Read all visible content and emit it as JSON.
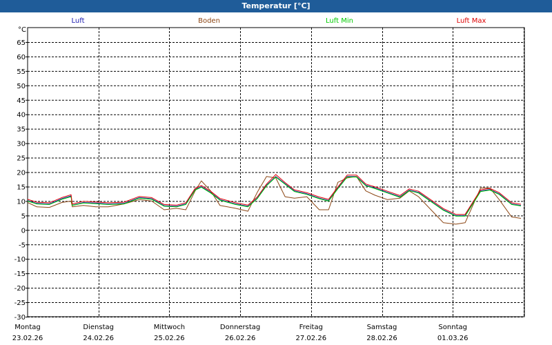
{
  "title": "Temperatur [°C]",
  "colors": {
    "titlebar": "#1f5c99"
  },
  "chart_data": {
    "type": "line",
    "title": "Temperatur [°C]",
    "ylabel": "°C",
    "xlabel": "",
    "ylim": [
      -30,
      70
    ],
    "yticks": [
      65,
      60,
      55,
      50,
      45,
      40,
      35,
      30,
      25,
      20,
      15,
      10,
      5,
      0,
      -5,
      -10,
      -15,
      -20,
      -25,
      -30
    ],
    "grid": true,
    "legend_position": "top",
    "x_ticks": [
      {
        "day": "Montag",
        "date": "23.02.26"
      },
      {
        "day": "Dienstag",
        "date": "24.02.26"
      },
      {
        "day": "Mittwoch",
        "date": "25.02.26"
      },
      {
        "day": "Donnerstag",
        "date": "26.02.26"
      },
      {
        "day": "Freitag",
        "date": "27.02.26"
      },
      {
        "day": "Samstag",
        "date": "28.02.26"
      },
      {
        "day": "Sonntag",
        "date": "01.03.26"
      }
    ],
    "x_unit": "days since 23.02.26 00:00",
    "xlim": [
      0,
      7.2
    ],
    "series": [
      {
        "name": "Luft",
        "color": "#1a1ab0",
        "points": [
          [
            0,
            10.2
          ],
          [
            0.15,
            9.2
          ],
          [
            0.35,
            9.0
          ],
          [
            0.55,
            10.8
          ],
          [
            0.7,
            11.8
          ],
          [
            0.72,
            8.6
          ],
          [
            0.9,
            9.5
          ],
          [
            1.1,
            9.3
          ],
          [
            1.3,
            9.0
          ],
          [
            1.55,
            9.2
          ],
          [
            1.8,
            11.2
          ],
          [
            2.0,
            10.8
          ],
          [
            2.2,
            8.4
          ],
          [
            2.4,
            8.2
          ],
          [
            2.55,
            9.0
          ],
          [
            2.7,
            14.0
          ],
          [
            2.8,
            15.0
          ],
          [
            2.95,
            13.0
          ],
          [
            3.1,
            10.5
          ],
          [
            3.35,
            9.0
          ],
          [
            3.55,
            8.2
          ],
          [
            3.7,
            11.0
          ],
          [
            3.85,
            15.5
          ],
          [
            4.0,
            18.5
          ],
          [
            4.15,
            16.0
          ],
          [
            4.3,
            13.5
          ],
          [
            4.5,
            12.5
          ],
          [
            4.7,
            11.0
          ],
          [
            4.85,
            10.2
          ],
          [
            5.0,
            14.5
          ],
          [
            5.15,
            18.5
          ],
          [
            5.3,
            18.5
          ],
          [
            5.45,
            15.5
          ],
          [
            5.6,
            14.5
          ],
          [
            5.8,
            13.0
          ],
          [
            6.0,
            11.5
          ],
          [
            6.15,
            13.8
          ],
          [
            6.3,
            13.0
          ],
          [
            6.5,
            10.0
          ],
          [
            6.7,
            7.0
          ],
          [
            6.9,
            5.0
          ],
          [
            7.05,
            5.0
          ],
          [
            7.3,
            13.5
          ],
          [
            7.45,
            14.0
          ],
          [
            7.6,
            12.5
          ],
          [
            7.8,
            9.0
          ],
          [
            7.95,
            8.5
          ]
        ]
      },
      {
        "name": "Boden",
        "color": "#8b4513",
        "points": [
          [
            0,
            9.5
          ],
          [
            0.15,
            8.0
          ],
          [
            0.35,
            7.8
          ],
          [
            0.55,
            9.5
          ],
          [
            0.7,
            10.0
          ],
          [
            0.72,
            8.0
          ],
          [
            0.9,
            8.5
          ],
          [
            1.1,
            8.0
          ],
          [
            1.3,
            8.0
          ],
          [
            1.55,
            9.0
          ],
          [
            1.8,
            10.5
          ],
          [
            2.0,
            10.0
          ],
          [
            2.2,
            7.0
          ],
          [
            2.4,
            7.5
          ],
          [
            2.55,
            7.0
          ],
          [
            2.7,
            13.5
          ],
          [
            2.8,
            17.0
          ],
          [
            2.95,
            13.5
          ],
          [
            3.1,
            8.5
          ],
          [
            3.35,
            7.5
          ],
          [
            3.55,
            6.5
          ],
          [
            3.7,
            13.0
          ],
          [
            3.85,
            18.5
          ],
          [
            4.0,
            18.0
          ],
          [
            4.15,
            11.5
          ],
          [
            4.3,
            11.0
          ],
          [
            4.5,
            11.5
          ],
          [
            4.7,
            7.0
          ],
          [
            4.85,
            7.0
          ],
          [
            5.0,
            16.5
          ],
          [
            5.15,
            18.0
          ],
          [
            5.3,
            18.5
          ],
          [
            5.45,
            13.5
          ],
          [
            5.6,
            12.0
          ],
          [
            5.8,
            10.5
          ],
          [
            6.0,
            11.0
          ],
          [
            6.15,
            13.5
          ],
          [
            6.3,
            11.5
          ],
          [
            6.5,
            7.0
          ],
          [
            6.7,
            2.5
          ],
          [
            6.9,
            2.0
          ],
          [
            7.05,
            2.5
          ],
          [
            7.3,
            14.5
          ],
          [
            7.45,
            14.5
          ],
          [
            7.6,
            10.5
          ],
          [
            7.8,
            4.5
          ],
          [
            7.95,
            4.0
          ]
        ]
      },
      {
        "name": "Luft Min",
        "color": "#00cc00",
        "points": [
          [
            0,
            10.0
          ],
          [
            0.15,
            9.0
          ],
          [
            0.35,
            8.8
          ],
          [
            0.55,
            10.6
          ],
          [
            0.7,
            11.5
          ],
          [
            0.72,
            8.5
          ],
          [
            0.9,
            9.3
          ],
          [
            1.1,
            9.1
          ],
          [
            1.3,
            8.8
          ],
          [
            1.55,
            9.0
          ],
          [
            1.8,
            11.0
          ],
          [
            2.0,
            10.6
          ],
          [
            2.2,
            8.2
          ],
          [
            2.4,
            8.0
          ],
          [
            2.55,
            8.8
          ],
          [
            2.7,
            13.8
          ],
          [
            2.8,
            14.8
          ],
          [
            2.95,
            12.8
          ],
          [
            3.1,
            10.3
          ],
          [
            3.35,
            8.8
          ],
          [
            3.55,
            8.0
          ],
          [
            3.7,
            10.8
          ],
          [
            3.85,
            15.3
          ],
          [
            4.0,
            18.3
          ],
          [
            4.15,
            15.8
          ],
          [
            4.3,
            13.3
          ],
          [
            4.5,
            12.3
          ],
          [
            4.7,
            10.8
          ],
          [
            4.85,
            10.0
          ],
          [
            5.0,
            14.3
          ],
          [
            5.15,
            18.3
          ],
          [
            5.3,
            18.3
          ],
          [
            5.45,
            15.3
          ],
          [
            5.6,
            14.3
          ],
          [
            5.8,
            12.8
          ],
          [
            6.0,
            11.3
          ],
          [
            6.15,
            13.6
          ],
          [
            6.3,
            12.8
          ],
          [
            6.5,
            9.8
          ],
          [
            6.7,
            6.8
          ],
          [
            6.9,
            4.8
          ],
          [
            7.05,
            4.8
          ],
          [
            7.3,
            13.3
          ],
          [
            7.45,
            13.8
          ],
          [
            7.6,
            12.3
          ],
          [
            7.8,
            8.8
          ],
          [
            7.95,
            8.3
          ]
        ]
      },
      {
        "name": "Luft Max",
        "color": "#dd0000",
        "points": [
          [
            0,
            10.6
          ],
          [
            0.15,
            9.6
          ],
          [
            0.35,
            9.4
          ],
          [
            0.55,
            11.2
          ],
          [
            0.7,
            12.2
          ],
          [
            0.72,
            9.0
          ],
          [
            0.9,
            9.9
          ],
          [
            1.1,
            9.7
          ],
          [
            1.3,
            9.4
          ],
          [
            1.55,
            9.6
          ],
          [
            1.8,
            11.6
          ],
          [
            2.0,
            11.2
          ],
          [
            2.2,
            8.8
          ],
          [
            2.4,
            8.6
          ],
          [
            2.55,
            9.4
          ],
          [
            2.7,
            14.4
          ],
          [
            2.8,
            15.4
          ],
          [
            2.95,
            13.4
          ],
          [
            3.1,
            10.9
          ],
          [
            3.35,
            9.4
          ],
          [
            3.55,
            8.6
          ],
          [
            3.7,
            11.4
          ],
          [
            3.85,
            15.9
          ],
          [
            4.0,
            19.2
          ],
          [
            4.15,
            16.4
          ],
          [
            4.3,
            13.9
          ],
          [
            4.5,
            12.9
          ],
          [
            4.7,
            11.4
          ],
          [
            4.85,
            10.6
          ],
          [
            5.0,
            14.9
          ],
          [
            5.15,
            19.0
          ],
          [
            5.3,
            19.0
          ],
          [
            5.45,
            15.9
          ],
          [
            5.6,
            14.9
          ],
          [
            5.8,
            13.4
          ],
          [
            6.0,
            11.9
          ],
          [
            6.15,
            14.2
          ],
          [
            6.3,
            13.4
          ],
          [
            6.5,
            10.4
          ],
          [
            6.7,
            7.4
          ],
          [
            6.9,
            5.4
          ],
          [
            7.05,
            5.4
          ],
          [
            7.3,
            13.9
          ],
          [
            7.45,
            14.4
          ],
          [
            7.6,
            12.9
          ],
          [
            7.8,
            9.4
          ],
          [
            7.95,
            8.9
          ]
        ]
      }
    ]
  }
}
